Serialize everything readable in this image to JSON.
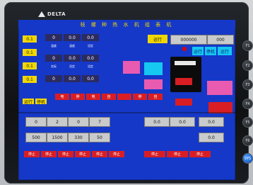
{
  "hmi": {
    "brand": "DELTA",
    "title": "枝 螺 种 热 水 机 组 表 机",
    "left_column": [
      "0.1",
      "0.1",
      "0.1",
      "0.1"
    ],
    "readouts": {
      "r1": [
        "0",
        "0.0",
        "0.0"
      ],
      "r2": [
        "0",
        "0.0",
        "0.0"
      ],
      "r3": [
        "0",
        "0.0",
        "0.0"
      ]
    },
    "top_right": {
      "status_label": "运行",
      "display_top": "000000",
      "display_top_right": "000",
      "sub_labels": [
        "运行",
        "停机",
        "运行",
        "开关"
      ]
    },
    "small_labels": [
      "温度",
      "温度",
      "设定",
      "实际",
      "设定",
      "设定"
    ],
    "bottom_inputs": [
      "0",
      "2",
      "0",
      "7"
    ],
    "mid_red_labels": [
      "电",
      "停",
      "电",
      "自",
      "",
      "停",
      "自"
    ],
    "side_labels": [
      "运行",
      "停机"
    ],
    "bottom_row2": [
      "500",
      "1500",
      "330",
      "50"
    ],
    "bottom_right": [
      "0.0",
      "0.0",
      "0.0",
      "0.0"
    ],
    "bottom_buttons": [
      "停止",
      "停止",
      "停止",
      "停止",
      "停止",
      "停止",
      "停止",
      "停止",
      "停止"
    ],
    "function_keys": [
      "F1",
      "F2",
      "F3",
      "F4",
      "F5",
      "F6",
      "SYS"
    ]
  }
}
